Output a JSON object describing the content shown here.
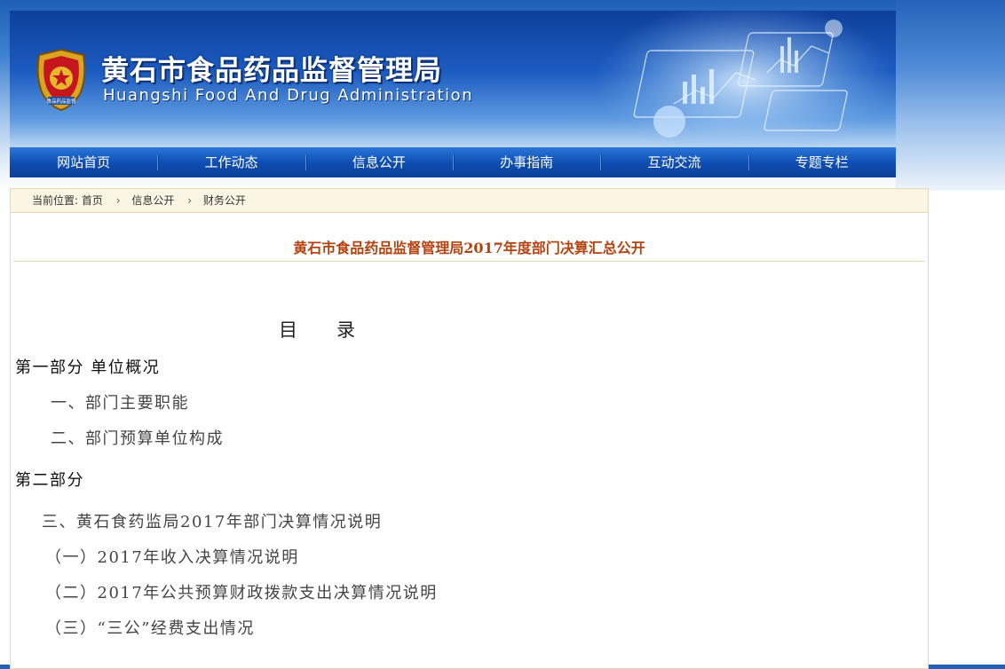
{
  "header": {
    "title": "黄石市食品药品监督管理局",
    "subtitle": "Huangshi Food And Drug Administration",
    "emblem_icon": "police-emblem-icon",
    "emblem_text": "食品药品监督"
  },
  "nav": {
    "items": [
      "网站首页",
      "工作动态",
      "信息公开",
      "办事指南",
      "互动交流",
      "专题专栏"
    ]
  },
  "breadcrumb": {
    "label": "当前位置:",
    "items": [
      "首页",
      "信息公开",
      "财务公开"
    ],
    "separator_icon": "chevron-right-icon"
  },
  "article": {
    "title": "黄石市食品药品监督管理局2017年度部门决算汇总公开",
    "toc_heading": "目录",
    "lines": [
      "第一部分  单位概况",
      "一、部门主要职能",
      "二、部门预算单位构成",
      "第二部分",
      "三、黄石食药监局2017年部门决算情况说明",
      "（一）2017年收入决算情况说明",
      "（二）2017年公共预算财政拨款支出决算情况说明",
      "（三）“三公”经费支出情况"
    ]
  },
  "colors": {
    "nav": "#0f4fb3",
    "title": "#b5430f",
    "breadcrumb_bg": "#fbf6e3",
    "border": "#e6d8b5"
  }
}
